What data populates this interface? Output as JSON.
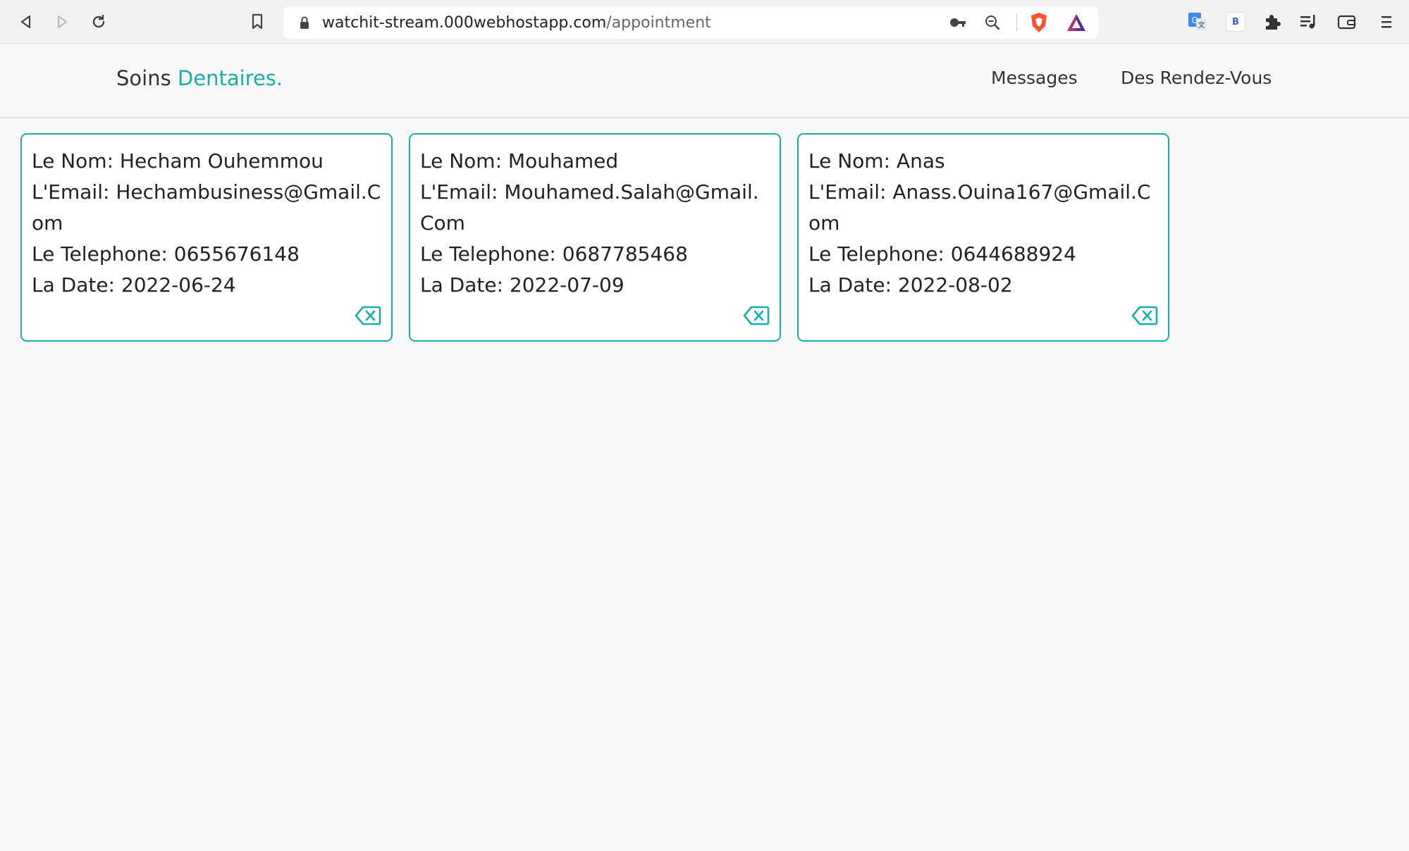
{
  "browser": {
    "url_domain": "watchit-stream.000webhostapp.com",
    "url_path": "/appointment",
    "icons": [
      "back-icon",
      "forward-icon",
      "reload-icon",
      "bookmark-icon",
      "lock-icon",
      "key-icon",
      "zoom-out-icon",
      "brave-shield-icon",
      "brave-rewards-icon",
      "translate-icon",
      "extension-b-icon",
      "extensions-puzzle-icon",
      "media-playlist-icon",
      "wallet-icon",
      "menu-icon"
    ],
    "ext_b_label": "B"
  },
  "header": {
    "logo_main": "Soins ",
    "logo_accent": "Dentaires.",
    "nav": [
      {
        "label": "Messages"
      },
      {
        "label": "Des Rendez-Vous"
      }
    ]
  },
  "colors": {
    "accent": "#17b0a7"
  },
  "appointments": [
    {
      "name": "Le Nom: Hecham Ouhemmou",
      "email": "L'Email: Hechambusiness@Gmail.Com",
      "phone": "Le Telephone: 0655676148",
      "date": "La Date: 2022-06-24"
    },
    {
      "name": "Le Nom: Mouhamed",
      "email": "L'Email: Mouhamed.Salah@Gmail.Com",
      "phone": "Le Telephone: 0687785468",
      "date": "La Date: 2022-07-09"
    },
    {
      "name": "Le Nom: Anas",
      "email": "L'Email: Anass.Ouina167@Gmail.Com",
      "phone": "Le Telephone: 0644688924",
      "date": "La Date: 2022-08-02"
    }
  ]
}
